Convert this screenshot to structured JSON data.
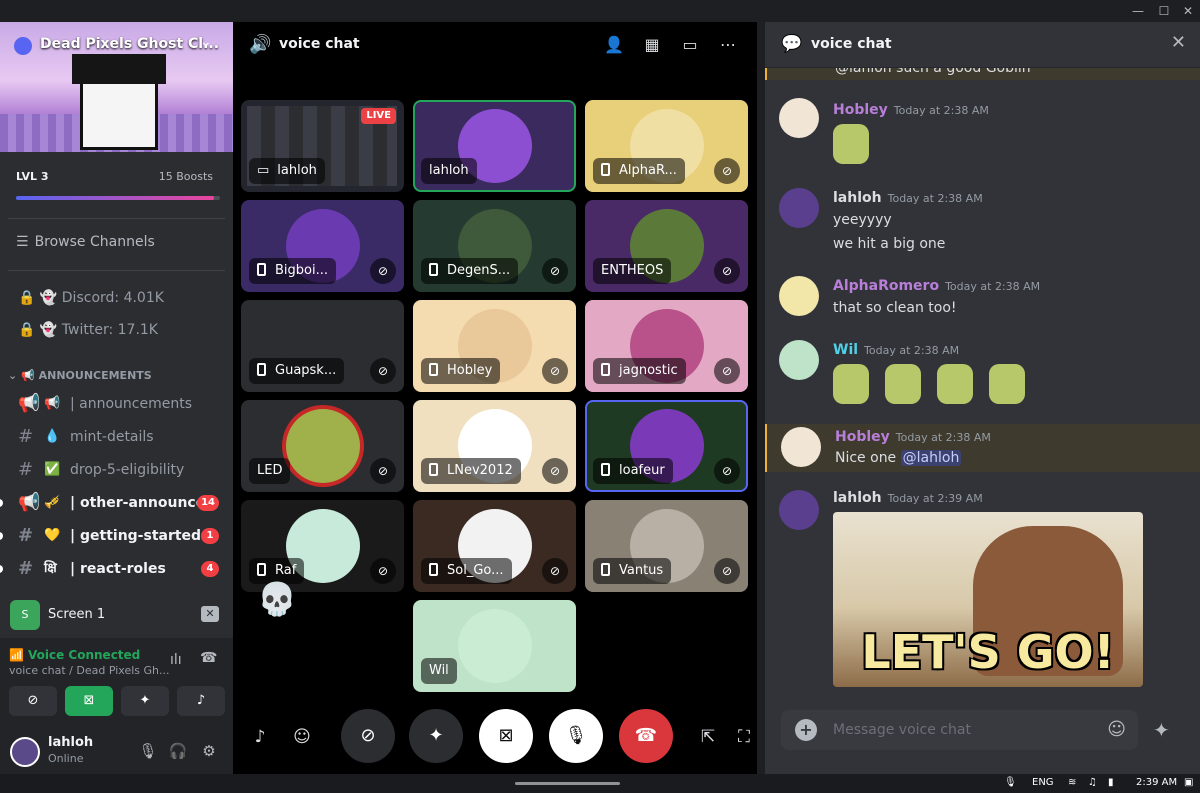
{
  "window": {
    "controls": [
      "—",
      "☐",
      "✕"
    ]
  },
  "server": {
    "name": "Dead Pixels Ghost Cl...",
    "level": "LVL 3",
    "boosts": "15 Boosts",
    "boost_progress": 0.97,
    "browse": "Browse Channels",
    "stats": [
      {
        "label": "Discord: 4.01K"
      },
      {
        "label": "Twitter: 17.1K"
      }
    ],
    "category": "ANNOUNCEMENTS",
    "channels": [
      {
        "emoji": "📢",
        "name": "| announcements",
        "unread": false,
        "badge": ""
      },
      {
        "emoji": "💧",
        "name": "mint-details",
        "unread": false,
        "badge": ""
      },
      {
        "emoji": "✅",
        "name": "drop-5-eligibility",
        "unread": false,
        "badge": ""
      },
      {
        "emoji": "🎺",
        "name": "| other-announce",
        "unread": true,
        "badge": "14"
      },
      {
        "emoji": "💛",
        "name": "| getting-started",
        "unread": true,
        "badge": "1"
      },
      {
        "emoji": "क्षि",
        "name": "| react-roles",
        "unread": true,
        "badge": "4"
      }
    ]
  },
  "screen": {
    "icon": "S",
    "label": "Screen 1"
  },
  "voice": {
    "status": "Voice Connected",
    "location": "voice chat / Dead Pixels Gh..."
  },
  "user": {
    "name": "lahloh",
    "status": "Online"
  },
  "stage": {
    "title": "voice chat",
    "live_badge": "LIVE",
    "tiles": [
      {
        "name": "lahloh"
      },
      {
        "name": "lahloh"
      },
      {
        "name": "AlphaR..."
      },
      {
        "name": "Bigboi..."
      },
      {
        "name": "DegenS..."
      },
      {
        "name": "ENTHEOS"
      },
      {
        "name": "Guapsk..."
      },
      {
        "name": "Hobley"
      },
      {
        "name": "jagnostic"
      },
      {
        "name": "LED"
      },
      {
        "name": "LNev2012"
      },
      {
        "name": "loafeur"
      },
      {
        "name": "Raf"
      },
      {
        "name": "Sol_Go..."
      },
      {
        "name": "Vantus"
      },
      {
        "name": "Wil"
      }
    ]
  },
  "chat": {
    "title": "voice chat",
    "top_partial": "@lahloh such a good Goblin",
    "messages": [
      {
        "author": "Hobley",
        "time": "Today at 2:38 AM",
        "color": "#b87fd9"
      },
      {
        "author": "lahloh",
        "time": "Today at 2:38 AM",
        "color": "#dbdee1",
        "lines": [
          "yeeyyyy",
          "we hit a big one"
        ]
      },
      {
        "author": "AlphaRomero",
        "time": "Today at 2:38 AM",
        "color": "#b87fd9",
        "lines": [
          "that so clean too!"
        ]
      },
      {
        "author": "Wil",
        "time": "Today at 2:38 AM",
        "color": "#4fd1e8"
      },
      {
        "author": "Hobley",
        "time": "Today at 2:38 AM",
        "color": "#b87fd9",
        "text": "Nice one",
        "mention": "@lahloh"
      },
      {
        "author": "lahloh",
        "time": "Today at 2:39 AM",
        "color": "#dbdee1",
        "gif_text": "LET'S GO!"
      }
    ],
    "placeholder": "Message voice chat"
  },
  "taskbar": {
    "lang": "ENG",
    "time": "2:39 AM"
  }
}
